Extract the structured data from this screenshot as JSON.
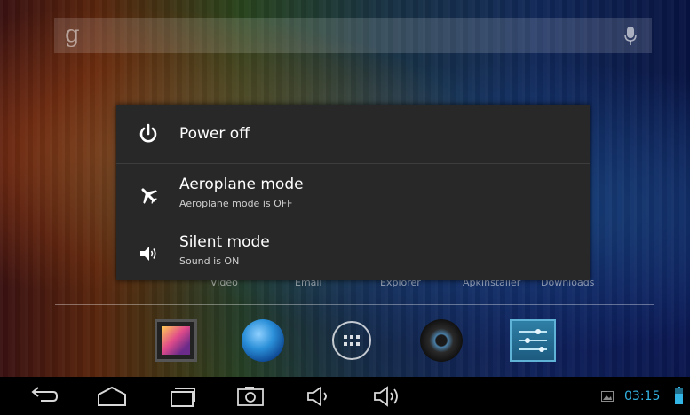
{
  "dialog": {
    "items": [
      {
        "title": "Power off",
        "subtitle": ""
      },
      {
        "title": "Aeroplane mode",
        "subtitle": "Aeroplane mode is OFF"
      },
      {
        "title": "Silent mode",
        "subtitle": "Sound is ON"
      }
    ]
  },
  "home": {
    "labels": [
      "Video",
      "Email",
      "Explorer",
      "ApkInstaller",
      "Downloads"
    ]
  },
  "statusbar": {
    "time": "03:15"
  },
  "colors": {
    "accent": "#33b5e5",
    "dialog_bg": "#282828"
  },
  "icons": {
    "search": "google-g-icon",
    "mic": "microphone-icon",
    "power": "power-icon",
    "airplane": "airplane-icon",
    "sound": "speaker-icon",
    "back": "back-icon",
    "home": "home-icon",
    "recents": "recent-apps-icon",
    "screenshot": "camera-icon",
    "volume_down": "volume-down-icon",
    "volume_up": "volume-up-icon",
    "gallery": "gallery-icon",
    "battery": "battery-icon"
  }
}
